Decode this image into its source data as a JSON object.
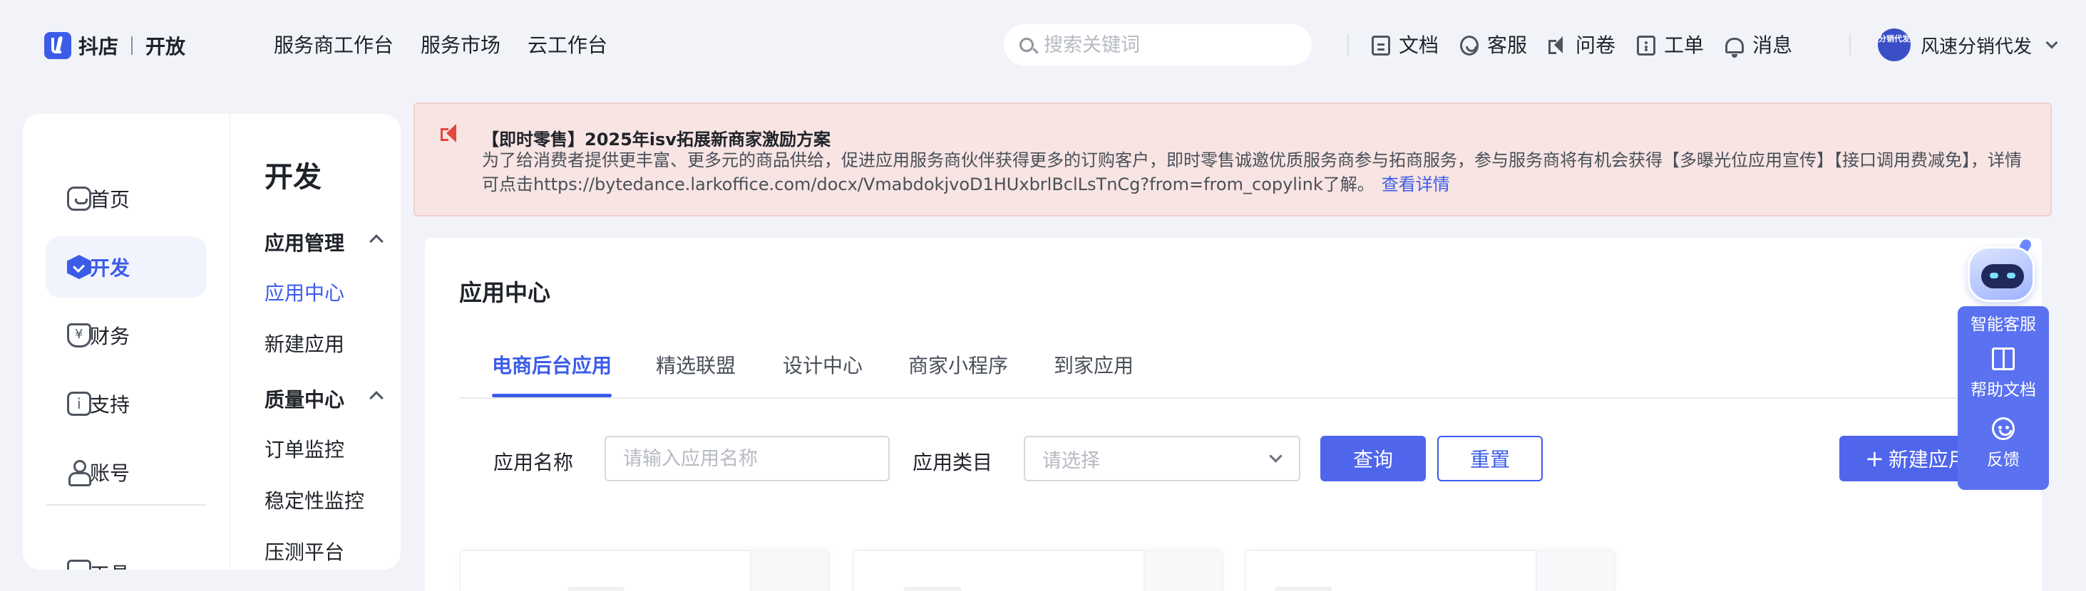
{
  "brand": {
    "name": "抖店",
    "sub": "开放"
  },
  "topnav": [
    "服务商工作台",
    "服务市场",
    "云工作台"
  ],
  "search": {
    "placeholder": "搜索关键词"
  },
  "tools": [
    {
      "icon": "document-icon",
      "label": "文档"
    },
    {
      "icon": "customer-service-icon",
      "label": "客服"
    },
    {
      "icon": "survey-icon",
      "label": "问卷"
    },
    {
      "icon": "ticket-icon",
      "label": "工单"
    },
    {
      "icon": "bell-icon",
      "label": "消息"
    }
  ],
  "user": {
    "avatar_text": "分销代发",
    "name": "风速分销代发"
  },
  "sidebar": {
    "items": [
      {
        "icon": "home-icon",
        "label": "首页"
      },
      {
        "icon": "develop-icon",
        "label": "开发",
        "active": true
      },
      {
        "icon": "finance-icon",
        "label": "财务"
      },
      {
        "icon": "support-icon",
        "label": "支持"
      },
      {
        "icon": "account-icon",
        "label": "账号"
      }
    ],
    "peek_label": "工具"
  },
  "subnav": {
    "title": "开发",
    "groups": [
      {
        "label": "应用管理",
        "items": [
          "应用中心",
          "新建应用"
        ]
      },
      {
        "label": "质量中心",
        "items": [
          "订单监控",
          "稳定性监控",
          "压测平台"
        ]
      }
    ],
    "active_item": "应用中心"
  },
  "banner": {
    "icon": "megaphone-icon",
    "title": "【即时零售】2025年isv拓展新商家激励方案",
    "body": "为了给消费者提供更丰富、更多元的商品供给，促进应用服务商伙伴获得更多的订购客户，即时零售诚邀优质服务商参与拓商服务，参与服务商将有机会获得【多曝光位应用宣传】【接口调用费减免】，详情可点击https://bytedance.larkoffice.com/docx/VmabdokjvoD1HUxbrlBclLsTnCg?from=from_copylink了解。",
    "link": "查看详情",
    "colors": {
      "bg": "#f7e4e3",
      "accent": "#e5453f"
    }
  },
  "main": {
    "title": "应用中心",
    "tabs": [
      "电商后台应用",
      "精选联盟",
      "设计中心",
      "商家小程序",
      "到家应用"
    ],
    "active_tab": "电商后台应用",
    "filters": {
      "name_label": "应用名称",
      "name_placeholder": "请输入应用名称",
      "category_label": "应用类目",
      "category_placeholder": "请选择"
    },
    "buttons": {
      "query": "查询",
      "reset": "重置",
      "create": "新建应用"
    }
  },
  "assistant": {
    "items": [
      {
        "icon": "robot-icon",
        "label": "智能客服"
      },
      {
        "icon": "book-icon",
        "label": "帮助文档"
      },
      {
        "icon": "feedback-icon",
        "label": "反馈"
      }
    ]
  },
  "colors": {
    "primary": "#3c5ce8",
    "button": "#4e65ec",
    "page_bg": "#f1f3f9"
  }
}
